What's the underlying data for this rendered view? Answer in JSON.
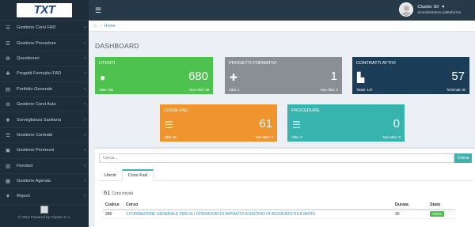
{
  "brand": {
    "logo_text": "TXT"
  },
  "sidebar": {
    "items": [
      {
        "icon": "☰",
        "icon_name": "list-icon",
        "label": "Gestione Corsi FAD"
      },
      {
        "icon": "☰",
        "icon_name": "list-icon",
        "label": "Gestione Procedure"
      },
      {
        "icon": "✿",
        "icon_name": "cog-icon",
        "label": "Questionari"
      },
      {
        "icon": "✚",
        "icon_name": "puzzle-icon",
        "label": "Progetti Formativi FAD"
      },
      {
        "icon": "▤",
        "icon_name": "folder-icon",
        "label": "Portfolio Generale"
      },
      {
        "icon": "⚙",
        "icon_name": "cogs-icon",
        "label": "Gestione Corsi Aula"
      },
      {
        "icon": "✚",
        "icon_name": "health-icon",
        "label": "Sorveglianza Sanitaria"
      },
      {
        "icon": "☰",
        "icon_name": "contracts-icon",
        "label": "Gestione Contratti"
      },
      {
        "icon": "▣",
        "icon_name": "permissions-icon",
        "label": "Gestione Permessi"
      },
      {
        "icon": "▥",
        "icon_name": "suppliers-icon",
        "label": "Fornitori"
      },
      {
        "icon": "▦",
        "icon_name": "calendar-icon",
        "label": "Gestione Agenda"
      },
      {
        "icon": "▼",
        "icon_name": "filter-icon",
        "label": "Report"
      }
    ],
    "footer_text": "© 2015 Powered by Cluster S.r.l."
  },
  "header": {
    "user_name": "Cluster Srl",
    "user_role": "amministratore piattaforma"
  },
  "breadcrumb": {
    "home_label": "Home"
  },
  "page": {
    "title": "DASHBOARD"
  },
  "tiles": {
    "utenti": {
      "title": "Utenti",
      "value": "680",
      "foot_left": "Attivi: 591",
      "foot_right": "Non Attivi: 89"
    },
    "progetti": {
      "title": "Progetti Formativi",
      "value": "1",
      "foot_left": "Attivi: 1",
      "foot_right": "Non Attivi: 0"
    },
    "contratti": {
      "title": "Contratti attivi",
      "value": "57",
      "foot_left": "Totale: 147",
      "foot_right": "Terminati: 90"
    },
    "corsi": {
      "title": "Corsi FAD",
      "value": "61",
      "foot_left": "Attivi: 61",
      "foot_right": "Non Attivi: 0"
    },
    "procedure": {
      "title": "Procedure",
      "value": "0",
      "foot_left": "Attivi: 0",
      "foot_right": "Non Attivi: 0"
    }
  },
  "search": {
    "placeholder": "Cerca...",
    "button_label": "Cerca"
  },
  "tabs": [
    {
      "label": "Utenti"
    },
    {
      "label": "Corsi Fad"
    }
  ],
  "results": {
    "count": "61",
    "label": "Corsi trovati"
  },
  "table": {
    "headers": [
      "Codice",
      "Corso",
      "Durata",
      "Stato"
    ],
    "rows": [
      {
        "codice": "286",
        "corso": "1.FORMAZIONE GENERALE PER GLI OPERATORI DI IMPIANTO A RISCHIO DI INCIDENTE RILEVANTE",
        "durata": "30",
        "stato": "Attivo"
      }
    ]
  },
  "colors": {
    "sidebar": "#1f2d3a",
    "header": "#263a4a",
    "green": "#4ec24e",
    "gray": "#8a8f93",
    "navy": "#1c3d57",
    "orange": "#f0952e",
    "teal": "#36b4ad",
    "accent": "#3fb2b0"
  }
}
